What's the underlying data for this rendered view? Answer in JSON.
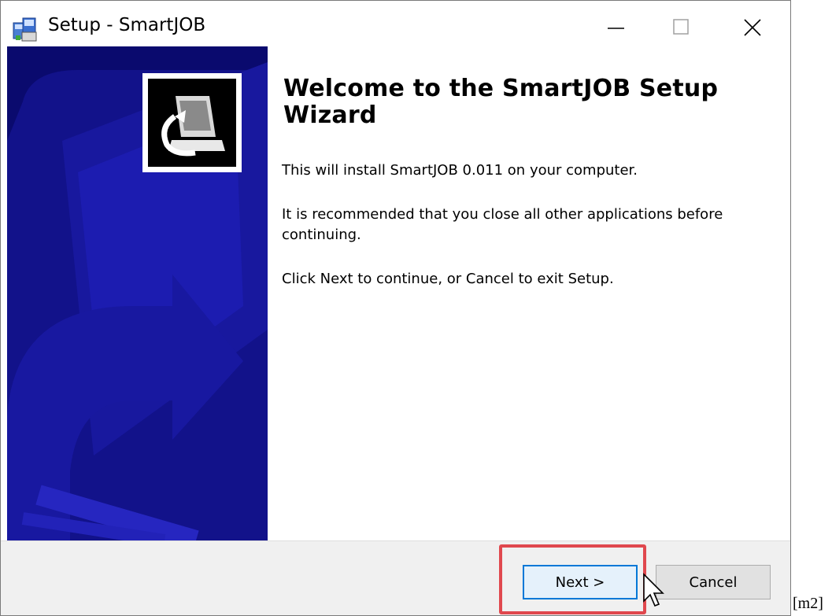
{
  "window": {
    "title": "Setup - SmartJOB",
    "controls": {
      "minimize": "minimize",
      "maximize": "maximize",
      "close": "close"
    }
  },
  "wizard": {
    "heading": "Welcome to the SmartJOB Setup Wizard",
    "paragraphs": [
      "This will install SmartJOB 0.011 on your computer.",
      "It is recommended that you close all other applications before continuing.",
      "Click Next to continue, or Cancel to exit Setup."
    ]
  },
  "buttons": {
    "next": "Next >",
    "cancel": "Cancel"
  },
  "annotation": {
    "marker": "[m2]",
    "highlight_color": "#e0484e"
  },
  "colors": {
    "side_panel": "#0a0a6e",
    "accent": "#0078d7"
  }
}
